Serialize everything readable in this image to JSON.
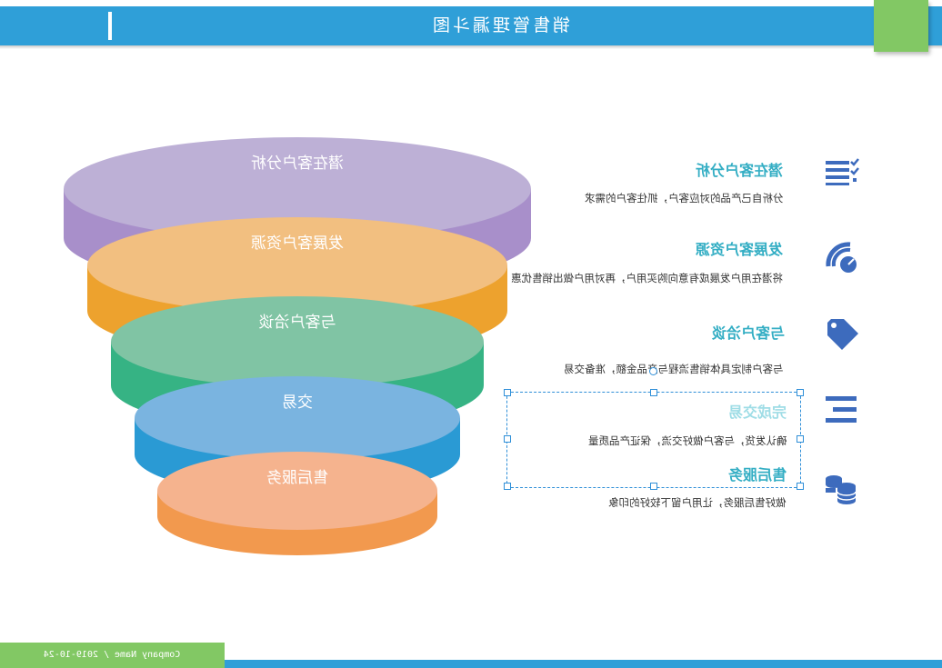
{
  "header": {
    "title": "销售管理漏斗图"
  },
  "footer": {
    "text": "Company Name / 2019-10-24"
  },
  "colors": {
    "brand_blue": "#2f9fd8",
    "brand_green": "#82c864",
    "title_teal": "#34aec4"
  },
  "funnel": {
    "levels": [
      {
        "label": "潜在客户分析",
        "top": "#bdb0d6",
        "side": "#a88fca"
      },
      {
        "label": "发展客户资源",
        "top": "#f2bf80",
        "side": "#eda22e"
      },
      {
        "label": "与客户洽谈",
        "top": "#80c4a4",
        "side": "#36b384"
      },
      {
        "label": "交易",
        "top": "#7ab4e0",
        "side": "#2a9ad4"
      },
      {
        "label": "售后服务",
        "top": "#f5b38e",
        "side": "#f2994e"
      }
    ]
  },
  "stages": [
    {
      "title": "潜在客户分析",
      "desc": "分析自己产品的对应客户，抓住客户的需求",
      "icon": "list-check-icon"
    },
    {
      "title": "发展客户资源",
      "desc": "将潜在用户发展成有意向购买用户，再对用户做出销售优惠",
      "icon": "signal-gauge-icon"
    },
    {
      "title": "与客户洽谈",
      "desc": "与客户制定具体销售流程与产品金额，准备交易",
      "icon": "price-tag-icon"
    },
    {
      "title": "完成交易",
      "desc": "确认发货，与客户做好交流，保证产品质量",
      "icon": "align-lines-icon"
    },
    {
      "title": "售后服务",
      "desc": "做好售后服务，让用户留下较好的印象",
      "icon": "coin-stack-icon"
    }
  ]
}
